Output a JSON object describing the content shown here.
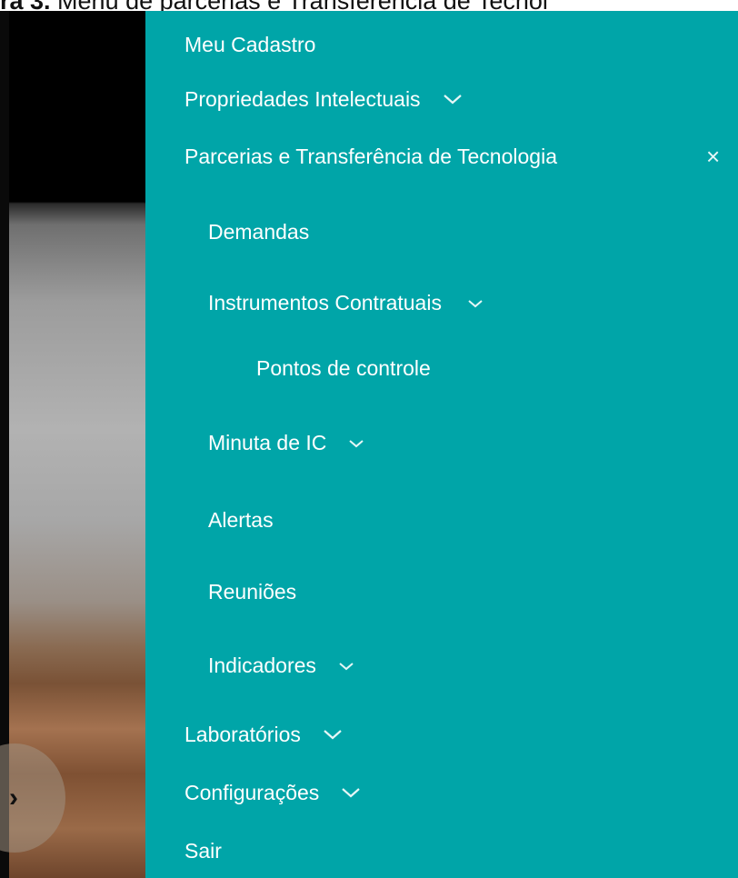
{
  "caption": {
    "prefix": "ra 3. ",
    "text": "Menu de parcerias e Transferência de Tecnol"
  },
  "menu": {
    "items": [
      {
        "label": "Meu Cadastro"
      },
      {
        "label": "Propriedades Intelectuais",
        "chevron": "chevron-down-icon"
      },
      {
        "label": "Parcerias e Transferência de Tecnologia",
        "close": "×"
      },
      {
        "label": "Demandas"
      },
      {
        "label": "Instrumentos Contratuais",
        "chevron": "chevron-down-icon"
      },
      {
        "label": "Pontos de controle"
      },
      {
        "label": "Minuta de IC",
        "chevron": "chevron-down-icon"
      },
      {
        "label": "Alertas"
      },
      {
        "label": "Reuniões"
      },
      {
        "label": "Indicadores",
        "chevron": "chevron-down-icon"
      },
      {
        "label": "Laboratórios",
        "chevron": "chevron-down-icon"
      },
      {
        "label": "Configurações",
        "chevron": "chevron-down-icon"
      },
      {
        "label": "Sair"
      }
    ]
  },
  "carousel": {
    "arrow": "›"
  },
  "colors": {
    "menu_bg": "#00a5a8",
    "text": "#ffffff"
  }
}
